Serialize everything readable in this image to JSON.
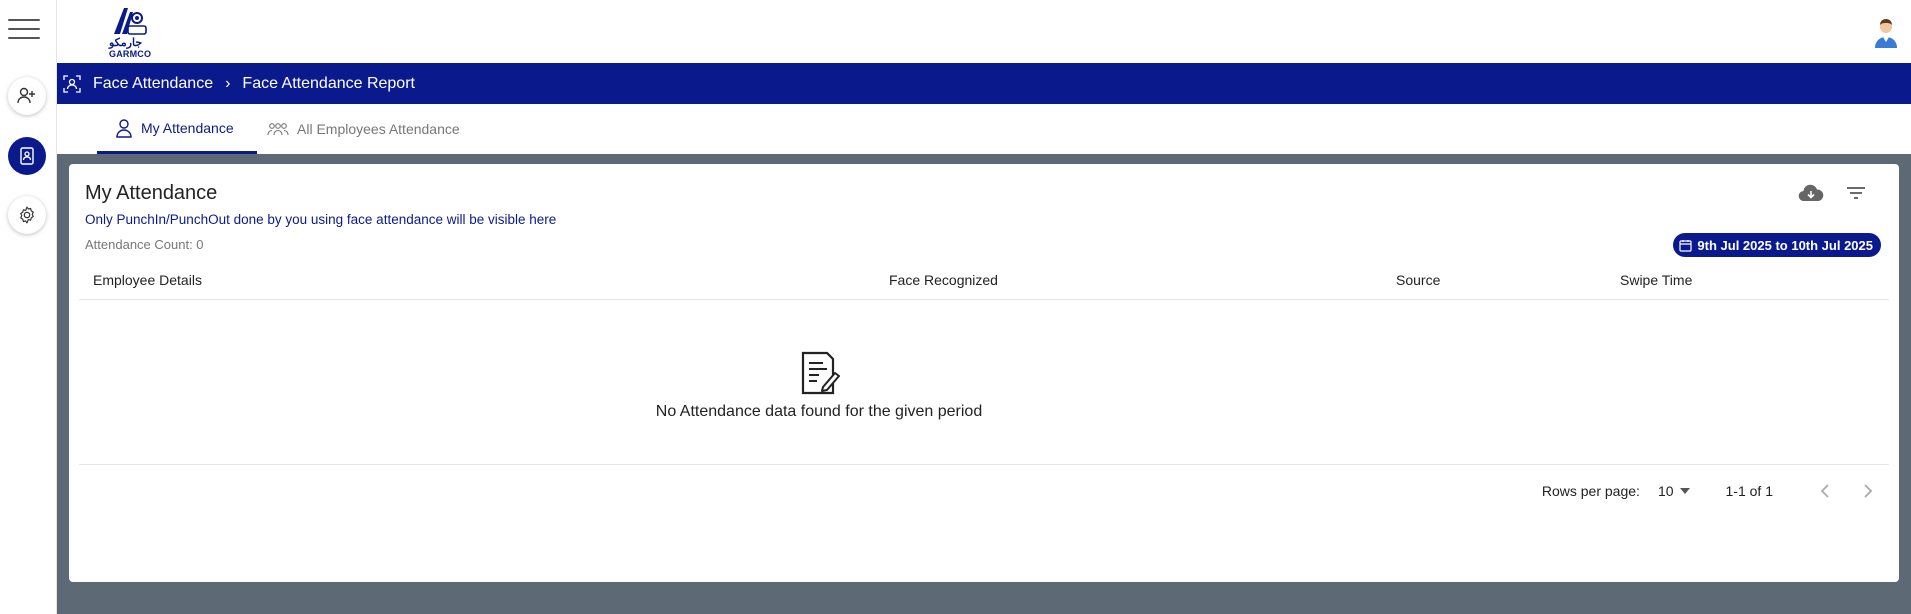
{
  "brand": {
    "arabic": "جارمكو",
    "name": "GARMCO"
  },
  "breadcrumb": {
    "parent": "Face Attendance",
    "separator": "›",
    "current": "Face Attendance Report"
  },
  "tabs": [
    {
      "label": "My Attendance",
      "active": true
    },
    {
      "label": "All Employees Attendance",
      "active": false
    }
  ],
  "card": {
    "title": "My Attendance",
    "subtitle": "Only PunchIn/PunchOut done by you using face attendance will be visible here",
    "count_label": "Attendance Count: 0",
    "date_range": "9th Jul 2025 to 10th Jul 2025"
  },
  "table": {
    "columns": [
      "Employee Details",
      "Face Recognized",
      "Source",
      "Swipe Time"
    ],
    "empty_message": "No Attendance data found for the given period"
  },
  "pagination": {
    "rows_per_page_label": "Rows per page:",
    "rows_per_page": "10",
    "range": "1-1 of 1"
  },
  "icons": [
    "menu-icon",
    "add-user-icon",
    "contact-book-icon",
    "gear-icon",
    "face-scan-icon",
    "person-icon",
    "group-icon",
    "cloud-download-icon",
    "filter-icon",
    "calendar-icon",
    "document-edit-icon",
    "chevron-left-icon",
    "chevron-right-icon",
    "caret-down-icon"
  ],
  "colors": {
    "primary": "#0a1a8c",
    "backdrop": "#5d6975"
  }
}
